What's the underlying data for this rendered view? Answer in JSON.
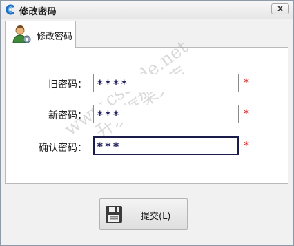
{
  "window": {
    "title": "修改密码"
  },
  "title_bar": {
    "close_label": "x"
  },
  "tab": {
    "label": "修改密码"
  },
  "form": {
    "fields": [
      {
        "label": "旧密码：",
        "value": "****",
        "required_mark": "*"
      },
      {
        "label": "新密码：",
        "value": "***",
        "required_mark": "*"
      },
      {
        "label": "确认密码：",
        "value": "***",
        "required_mark": "*"
      }
    ]
  },
  "watermark": {
    "line1": "www.cscode.net",
    "line2": "开发框架文库"
  },
  "actions": {
    "submit_label": "提交(L)"
  },
  "colors": {
    "required": "#d21a1a",
    "field_text": "#1c1c5a"
  }
}
